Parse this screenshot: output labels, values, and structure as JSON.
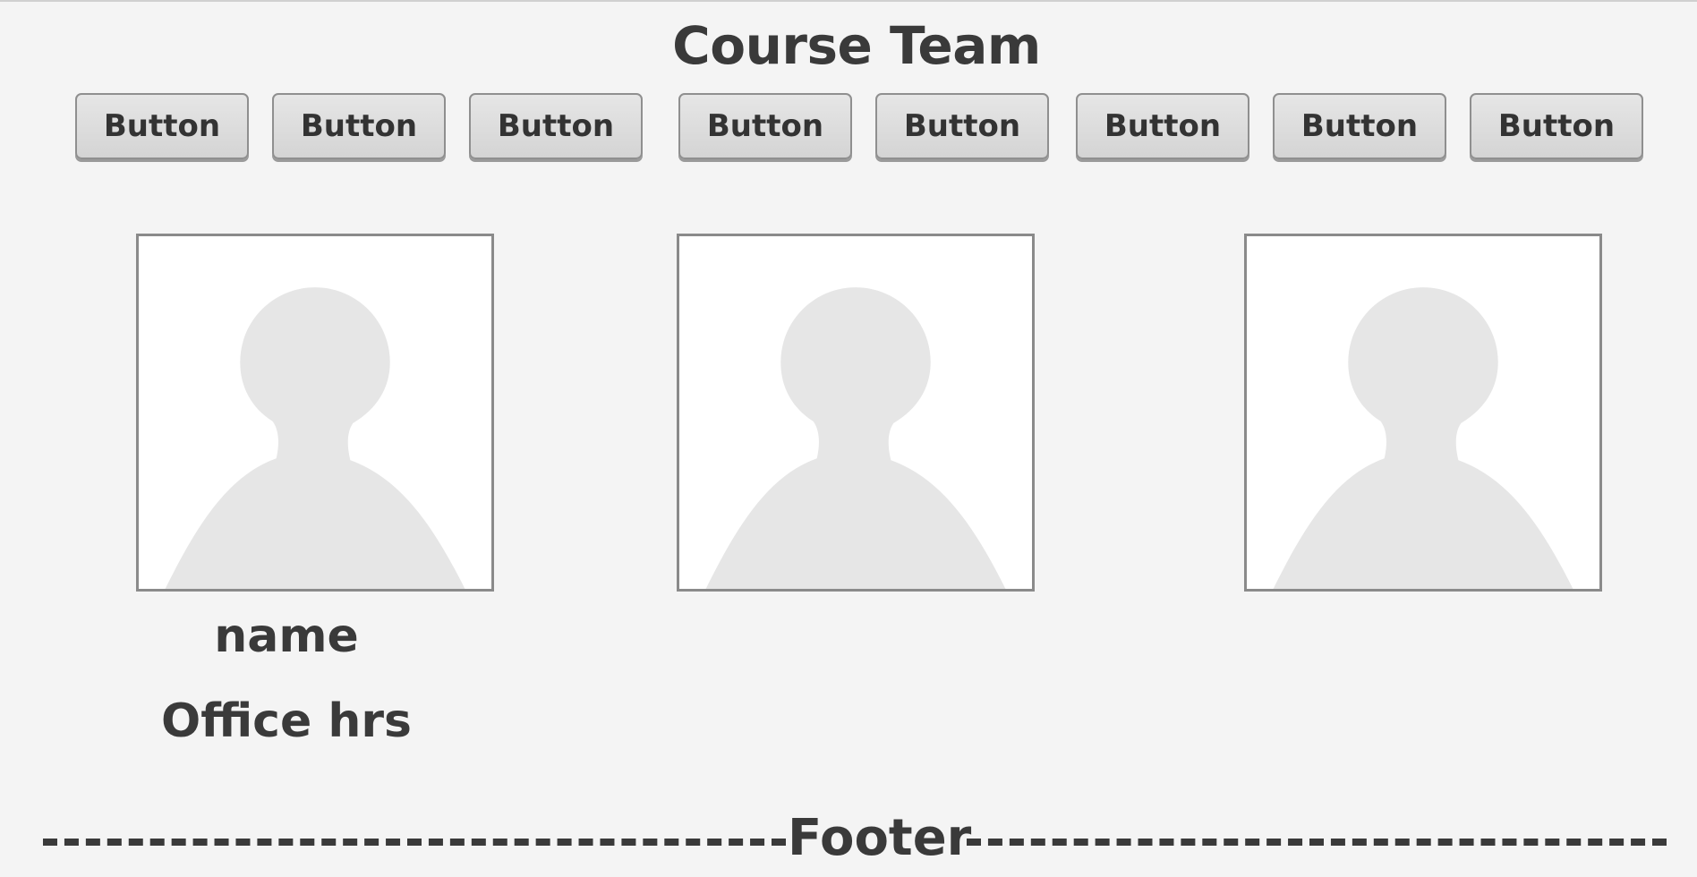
{
  "page": {
    "title": "Course Team"
  },
  "toolbar": {
    "buttons": [
      {
        "label": "Button"
      },
      {
        "label": "Button"
      },
      {
        "label": "Button"
      },
      {
        "label": "Button"
      },
      {
        "label": "Button"
      },
      {
        "label": "Button"
      },
      {
        "label": "Button"
      },
      {
        "label": "Button"
      }
    ]
  },
  "team": {
    "members": [
      {
        "avatar_icon": "person-placeholder-icon",
        "name": "name",
        "office_hours": "Office hrs"
      },
      {
        "avatar_icon": "person-placeholder-icon"
      },
      {
        "avatar_icon": "person-placeholder-icon"
      }
    ]
  },
  "footer": {
    "label": "Footer"
  },
  "colors": {
    "background": "#f4f4f4",
    "text": "#3a3a3a",
    "button_fill": "#dcdcdc",
    "button_border": "#8f8f8f",
    "avatar_border": "#8a8a8a",
    "avatar_silhouette": "#e6e6e6"
  }
}
